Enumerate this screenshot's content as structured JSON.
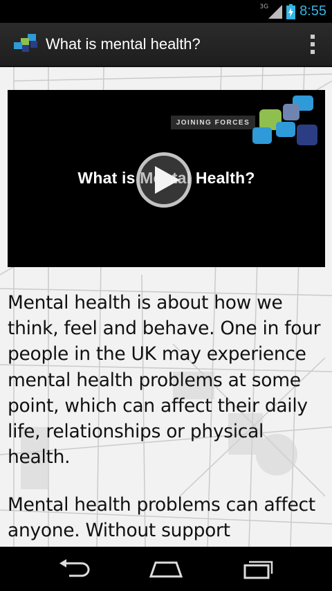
{
  "status_bar": {
    "network_type": "3G",
    "time": "8:55",
    "icons": [
      "signal-icon",
      "battery-charging-icon"
    ]
  },
  "action_bar": {
    "title": "What is mental health?",
    "logo_icon": "joining-forces-logo",
    "menu_icon": "overflow-menu-icon"
  },
  "video": {
    "brand": "JOINING FORCES",
    "title": "What is Mental Health?",
    "play_icon": "play-icon"
  },
  "content": {
    "paragraphs": [
      "Mental health is about how we think, feel and behave. One in four people in the UK may experience mental health problems at some point, which can affect their daily life, relationships or physical health.",
      "Mental health problems can affect anyone. Without support"
    ]
  },
  "nav_bar": {
    "icons": [
      "back-icon",
      "home-icon",
      "recent-apps-icon"
    ]
  },
  "colors": {
    "accent": "#33b5e5",
    "logo_green": "#8fbf4f",
    "logo_blue": "#2f9ad8",
    "logo_navy": "#2b3e84"
  }
}
